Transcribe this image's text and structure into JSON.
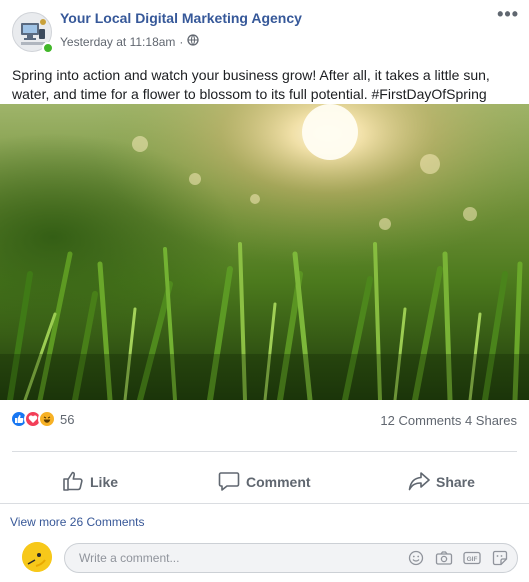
{
  "post": {
    "author": "Your Local Digital Marketing Agency",
    "timestamp": "Yesterday at 11:18am",
    "separator": "·",
    "privacy_icon": "globe-icon",
    "more_label": "•••",
    "text": "Spring into action and watch your business grow! After all, it takes a little sun, water, and time for a flower to blossom to its full potential. #FirstDayOfSpring"
  },
  "reactions": {
    "types": [
      "like-icon",
      "love-icon",
      "haha-icon"
    ],
    "count": "56",
    "comments_shares": "12 Comments 4 Shares",
    "colors": {
      "like": "#1877f2",
      "love": "#f33e58",
      "haha": "#f7b125"
    }
  },
  "actions": {
    "like": "Like",
    "comment": "Comment",
    "share": "Share"
  },
  "comments": {
    "view_more": "View more 26 Comments",
    "placeholder": "Write a comment...",
    "icons": [
      "emoji-icon",
      "camera-icon",
      "gif-icon",
      "sticker-icon"
    ]
  },
  "colors": {
    "link": "#365899",
    "online": "#42b72a"
  }
}
